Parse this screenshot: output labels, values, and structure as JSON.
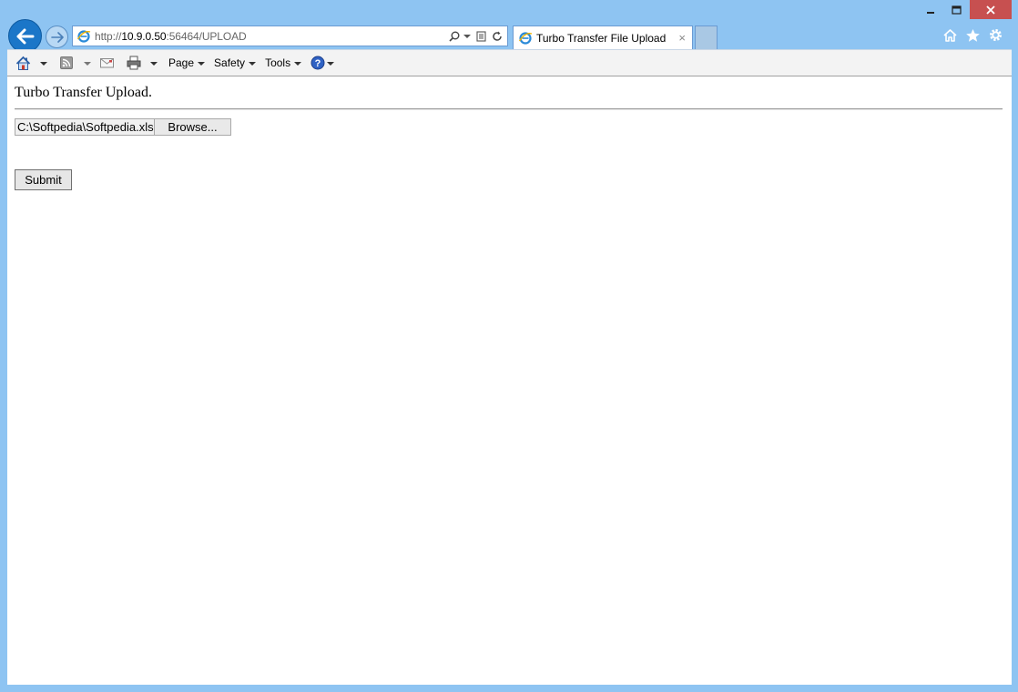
{
  "window": {
    "minimize_icon": "minimize-icon",
    "maximize_icon": "maximize-icon",
    "close_icon": "close-icon",
    "close_color": "#c75050"
  },
  "nav": {
    "back_icon": "back-arrow-icon",
    "forward_icon": "forward-arrow-icon"
  },
  "address_bar": {
    "url_prefix": "http://",
    "url_host": "10.9.0.50",
    "url_rest": ":56464/UPLOAD"
  },
  "tab": {
    "title": "Turbo Transfer File Upload",
    "close": "×"
  },
  "command_bar": {
    "page": "Page",
    "safety": "Safety",
    "tools": "Tools"
  },
  "page": {
    "heading": "Turbo Transfer Upload.",
    "file_value": "C:\\Softpedia\\Softpedia.xls",
    "browse_label": "Browse...",
    "submit_label": "Submit"
  },
  "colors": {
    "frame": "#8ec4f2",
    "accent": "#1b76c8"
  }
}
